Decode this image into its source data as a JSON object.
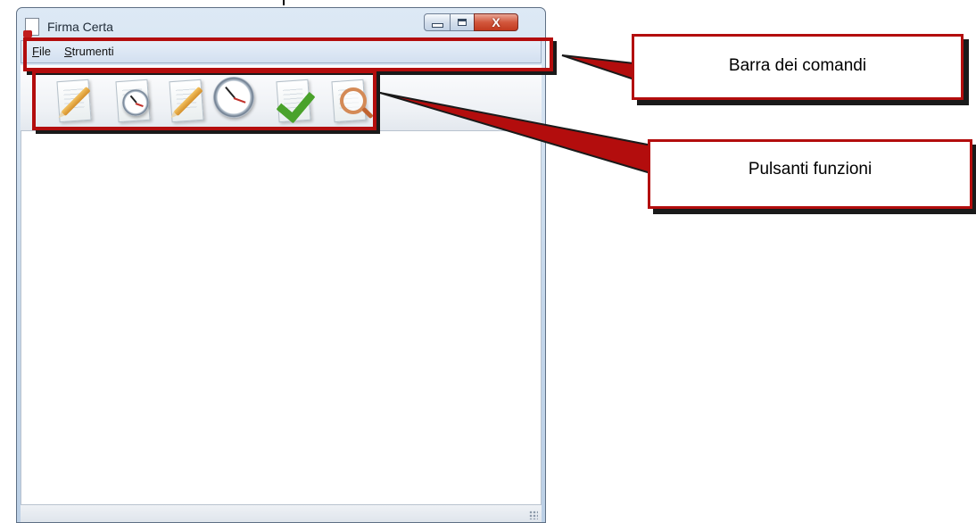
{
  "window": {
    "title": "Firma Certa",
    "controls": {
      "minimize": "minimize-icon",
      "maximize": "maximize-icon",
      "close_glyph": "X"
    }
  },
  "menubar": {
    "items": [
      {
        "mnemonic": "F",
        "rest": "ile"
      },
      {
        "mnemonic": "S",
        "rest": "trumenti"
      }
    ]
  },
  "toolbar": {
    "buttons": [
      {
        "icon": "sign-document-icon"
      },
      {
        "icon": "timestamp-document-icon"
      },
      {
        "icon": "sign-document-icon"
      },
      {
        "icon": "timestamp-icon"
      },
      {
        "icon": "verify-document-icon"
      },
      {
        "icon": "view-document-icon"
      }
    ]
  },
  "annotations": {
    "command_bar": "Barra dei comandi",
    "function_buttons": "Pulsanti funzioni",
    "accent_color": "#b30d0d"
  }
}
